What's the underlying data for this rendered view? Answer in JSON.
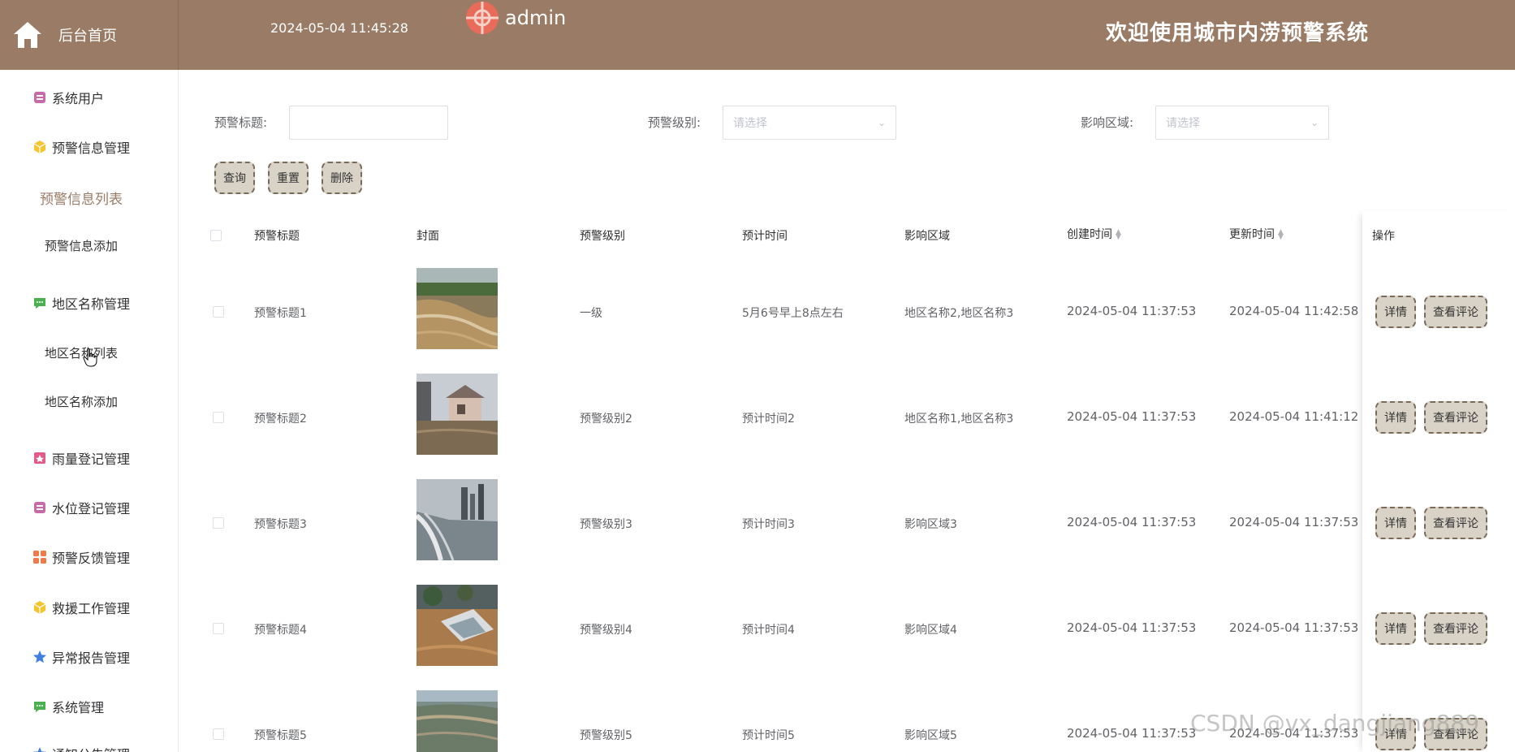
{
  "header": {
    "home_label": "后台首页",
    "datetime": "2024-05-04 11:45:28",
    "username": "admin",
    "site_title": "欢迎使用城市内涝预警系统",
    "bg_color": "#9a7b66"
  },
  "sidebar": {
    "items": [
      {
        "label": "系统用户",
        "icon": "archive-icon"
      },
      {
        "label": "预警信息管理",
        "icon": "cube-icon"
      },
      {
        "label": "预警信息列表"
      },
      {
        "label": "预警信息添加"
      },
      {
        "label": "地区名称管理",
        "icon": "chat-icon"
      },
      {
        "label": "地区名称列表"
      },
      {
        "label": "地区名称添加"
      },
      {
        "label": "雨量登记管理",
        "icon": "badge-icon"
      },
      {
        "label": "水位登记管理",
        "icon": "archive-icon"
      },
      {
        "label": "预警反馈管理",
        "icon": "grid-icon"
      },
      {
        "label": "救援工作管理",
        "icon": "cube-icon"
      },
      {
        "label": "异常报告管理",
        "icon": "star-icon"
      },
      {
        "label": "系统管理",
        "icon": "chat-icon"
      },
      {
        "label": "通知公告管理",
        "icon": "star-icon"
      }
    ]
  },
  "filters": {
    "title_label": "预警标题:",
    "level_label": "预警级别:",
    "level_placeholder": "请选择",
    "area_label": "影响区域:",
    "area_placeholder": "请选择"
  },
  "actions": {
    "query": "查询",
    "reset": "重置",
    "delete": "删除"
  },
  "table": {
    "headers": [
      "预警标题",
      "封面",
      "预警级别",
      "预计时间",
      "影响区域",
      "创建时间",
      "更新时间",
      "操作"
    ],
    "detail_label": "详情",
    "comment_label": "查看评论",
    "rows": [
      {
        "title": "预警标题1",
        "level": "一级",
        "time": "5月6号早上8点左右",
        "area": "地区名称2,地区名称3",
        "created": "2024-05-04 11:37:53",
        "updated": "2024-05-04 11:42:58"
      },
      {
        "title": "预警标题2",
        "level": "预警级别2",
        "time": "预计时间2",
        "area": "地区名称1,地区名称3",
        "created": "2024-05-04 11:37:53",
        "updated": "2024-05-04 11:41:12"
      },
      {
        "title": "预警标题3",
        "level": "预警级别3",
        "time": "预计时间3",
        "area": "影响区域3",
        "created": "2024-05-04 11:37:53",
        "updated": "2024-05-04 11:37:53"
      },
      {
        "title": "预警标题4",
        "level": "预警级别4",
        "time": "预计时间4",
        "area": "影响区域4",
        "created": "2024-05-04 11:37:53",
        "updated": "2024-05-04 11:37:53"
      },
      {
        "title": "预警标题5",
        "level": "预警级别5",
        "time": "预计时间5",
        "area": "影响区域5",
        "created": "2024-05-04 11:37:53",
        "updated": "2024-05-04 11:37:53"
      }
    ]
  },
  "watermark": "CSDN @vx_dangjiang889"
}
